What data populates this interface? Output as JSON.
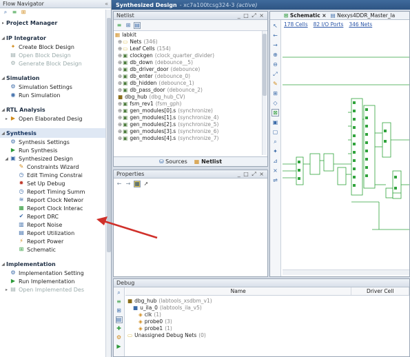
{
  "flow_nav": {
    "title": "Flow Navigator",
    "collapse_glyph": "«",
    "sections": [
      {
        "key": "pm",
        "label": "Project Manager",
        "items": []
      },
      {
        "key": "ip",
        "label": "IP Integrator",
        "items": [
          {
            "label": "Create Block Design",
            "icon": "create-block-design-icon",
            "glyph": "✦",
            "color": "#d08a1a",
            "disabled": false
          },
          {
            "label": "Open Block Design",
            "icon": "open-block-design-icon",
            "glyph": "▤",
            "color": "#9aa",
            "disabled": true
          },
          {
            "label": "Generate Block Design",
            "icon": "generate-block-design-icon",
            "glyph": "⚙",
            "color": "#9aa",
            "disabled": true
          }
        ]
      },
      {
        "key": "sim",
        "label": "Simulation",
        "items": [
          {
            "label": "Simulation Settings",
            "icon": "simulation-settings-icon",
            "glyph": "⚙",
            "color": "#3a6aa8",
            "disabled": false
          },
          {
            "label": "Run Simulation",
            "icon": "run-simulation-icon",
            "glyph": "◉",
            "color": "#3a6aa8",
            "disabled": false
          }
        ]
      },
      {
        "key": "rtl",
        "label": "RTL Analysis",
        "items": [
          {
            "label": "Open Elaborated Desig",
            "icon": "open-elaborated-design-icon",
            "glyph": "▶",
            "color": "#d08a1a",
            "disabled": false,
            "expandable": true
          }
        ]
      },
      {
        "key": "syn",
        "label": "Synthesis",
        "highlight": true,
        "items": [
          {
            "label": "Synthesis Settings",
            "icon": "synthesis-settings-icon",
            "glyph": "⚙",
            "color": "#3a6aa8",
            "disabled": false
          },
          {
            "label": "Run Synthesis",
            "icon": "run-synthesis-icon",
            "glyph": "▶",
            "color": "#2e9a3a",
            "disabled": false
          },
          {
            "label": "Synthesized Design",
            "icon": "synthesized-design-icon",
            "glyph": "▣",
            "color": "#3a6aa8",
            "disabled": false,
            "expanded": true
          }
        ]
      },
      {
        "key": "impl",
        "label": "Implementation",
        "items": [
          {
            "label": "Implementation Setting",
            "icon": "implementation-settings-icon",
            "glyph": "⚙",
            "color": "#3a6aa8",
            "disabled": false
          },
          {
            "label": "Run Implementation",
            "icon": "run-implementation-icon",
            "glyph": "▶",
            "color": "#2e9a3a",
            "disabled": false
          },
          {
            "label": "Open Implemented Des",
            "icon": "open-implemented-design-icon",
            "glyph": "▤",
            "color": "#9aa",
            "disabled": true,
            "expandable": true
          }
        ]
      }
    ],
    "synth_children": [
      {
        "label": "Constraints Wizard",
        "icon": "constraints-wizard-icon",
        "glyph": "✎",
        "color": "#d08a1a"
      },
      {
        "label": "Edit Timing Constrai",
        "icon": "edit-timing-constraints-icon",
        "glyph": "◷",
        "color": "#3a6aa8"
      },
      {
        "label": "Set Up Debug",
        "icon": "set-up-debug-icon",
        "glyph": "✹",
        "color": "#c0392b"
      },
      {
        "label": "Report Timing Summ",
        "icon": "report-timing-summary-icon",
        "glyph": "◷",
        "color": "#3a6aa8"
      },
      {
        "label": "Report Clock Networ",
        "icon": "report-clock-networks-icon",
        "glyph": "≋",
        "color": "#3a6aa8"
      },
      {
        "label": "Report Clock Interac",
        "icon": "report-clock-interaction-icon",
        "glyph": "▦",
        "color": "#2e9a3a"
      },
      {
        "label": "Report DRC",
        "icon": "report-drc-icon",
        "glyph": "✔",
        "color": "#3a6aa8"
      },
      {
        "label": "Report Noise",
        "icon": "report-noise-icon",
        "glyph": "▥",
        "color": "#3a6aa8"
      },
      {
        "label": "Report Utilization",
        "icon": "report-utilization-icon",
        "glyph": "▤",
        "color": "#3a6aa8"
      },
      {
        "label": "Report Power",
        "icon": "report-power-icon",
        "glyph": "⚡",
        "color": "#d08a1a"
      },
      {
        "label": "Schematic",
        "icon": "schematic-icon",
        "glyph": "⊞",
        "color": "#2e9a3a"
      }
    ]
  },
  "header": {
    "title": "Synthesized Design",
    "part": "- xc7a100tcsg324-3",
    "status": "(active)"
  },
  "netlist": {
    "title": "Netlist",
    "window_controls": "_ □ ⤢ ×",
    "root": "labkit",
    "rows": [
      {
        "name": "Nets",
        "count": "(346)",
        "kind": "folder"
      },
      {
        "name": "Leaf Cells",
        "count": "(154)",
        "kind": "folder"
      },
      {
        "name": "clockgen",
        "count": "(clock_quarter_divider)",
        "kind": "cell"
      },
      {
        "name": "db_down",
        "count": "(debounce__5)",
        "kind": "cell"
      },
      {
        "name": "db_driver_door",
        "count": "(debounce)",
        "kind": "cell"
      },
      {
        "name": "db_enter",
        "count": "(debounce_0)",
        "kind": "cell"
      },
      {
        "name": "db_hidden",
        "count": "(debounce_1)",
        "kind": "cell"
      },
      {
        "name": "db_pass_door",
        "count": "(debounce_2)",
        "kind": "cell"
      },
      {
        "name": "dbg_hub",
        "count": "(dbg_hub_CV)",
        "kind": "hub"
      },
      {
        "name": "fsm_rev1",
        "count": "(fsm_gph)",
        "kind": "cell"
      },
      {
        "name": "gen_modules[0].s",
        "count": "(synchronize)",
        "kind": "cell"
      },
      {
        "name": "gen_modules[1].s",
        "count": "(synchronize_4)",
        "kind": "cell"
      },
      {
        "name": "gen_modules[2].s",
        "count": "(synchronize_5)",
        "kind": "cell"
      },
      {
        "name": "gen_modules[3].s",
        "count": "(synchronize_6)",
        "kind": "cell"
      },
      {
        "name": "gen_modules[4].s",
        "count": "(synchronize_7)",
        "kind": "cell"
      }
    ],
    "tab_sources": "Sources",
    "tab_netlist": "Netlist"
  },
  "properties": {
    "title": "Properties",
    "window_controls": "_ □ ⤢ ×"
  },
  "schematic": {
    "tab_schematic": "Schematic",
    "tab_other": "Nexys4DDR_Master_la",
    "cells_link": "178 Cells",
    "ports_link": "82 I/O Ports",
    "nets_link": "346 Nets"
  },
  "debug": {
    "title": "Debug",
    "col_name": "Name",
    "col_driver": "Driver Cell",
    "rows": [
      {
        "indent": 0,
        "label": "dbg_hub",
        "detail": "(labtools_xsdbm_v1)",
        "icon": "debug-hub-icon"
      },
      {
        "indent": 1,
        "label": "u_ila_0",
        "detail": "(labtools_ila_v5)",
        "icon": "ila-icon"
      },
      {
        "indent": 2,
        "label": "clk",
        "detail": "(1)",
        "icon": "probe-icon"
      },
      {
        "indent": 2,
        "label": "probe0",
        "detail": "(3)",
        "icon": "probe-icon"
      },
      {
        "indent": 2,
        "label": "probe1",
        "detail": "(1)",
        "icon": "probe-icon"
      },
      {
        "indent": 0,
        "label": "Unassigned Debug Nets",
        "detail": "(0)",
        "icon": "unassigned-nets-icon"
      }
    ]
  },
  "colors": {
    "accent": "#2e5583",
    "annotation_arrow": "#d0302a",
    "schematic_lines": "#2fa33b"
  }
}
